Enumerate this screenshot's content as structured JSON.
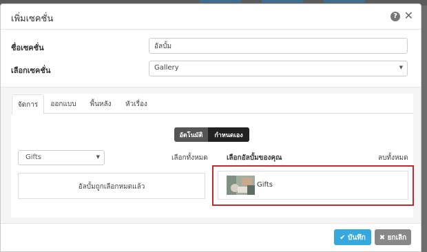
{
  "modal": {
    "title": "เพิ่มเซคชั่น",
    "help_icon": "question-circle-icon",
    "close_icon": "close-icon"
  },
  "form": {
    "section_name_label": "ชื่อเซคชั่น",
    "section_name_value": "อัลบั้ม",
    "section_type_label": "เลือกเซคชั่น",
    "section_type_value": "Gallery"
  },
  "tabs": [
    {
      "label": "จัดการ",
      "active": true
    },
    {
      "label": "ออกแบบ",
      "active": false
    },
    {
      "label": "พื้นหลัง",
      "active": false
    },
    {
      "label": "หัวเรื่อง",
      "active": false
    }
  ],
  "mode": {
    "auto_label": "อัตโนมัติ",
    "manual_label": "กำหนดเอง"
  },
  "albums": {
    "select_value": "Gifts",
    "select_all_label": "เลือกทั้งหมด",
    "your_albums_label": "เลือกอัลบั้มของคุณ",
    "delete_all_label": "ลบทั้งหมด",
    "empty_message": "อัลบั้มถูกเลือกหมดแล้ว",
    "selected": [
      {
        "name": "Gifts",
        "thumb_icon": "album-thumbnail"
      }
    ]
  },
  "footer": {
    "save_label": "บันทึก",
    "cancel_label": "ยกเลิก",
    "save_icon": "check-icon",
    "cancel_icon": "x-icon"
  },
  "colors": {
    "save_button": "#35a9de",
    "cancel_button": "#888888",
    "highlight_border": "#c0292d"
  }
}
